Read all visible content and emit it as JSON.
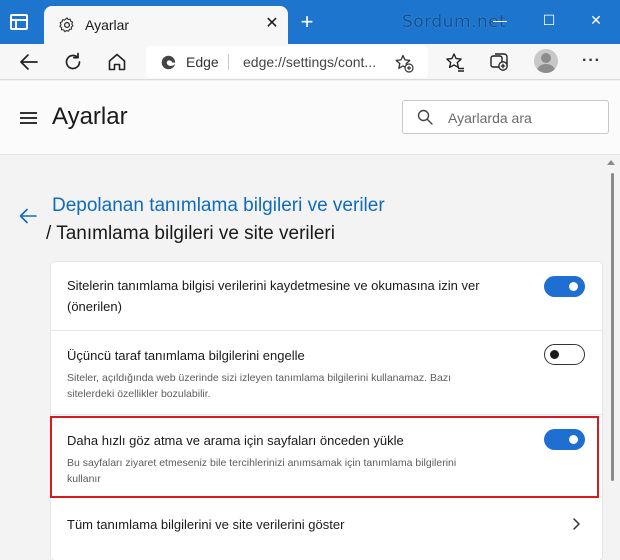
{
  "window": {
    "tab_title": "Ayarlar",
    "tab_close": "✕",
    "new_tab": "+",
    "watermark": "Sordum.net",
    "controls": {
      "minimize": "—",
      "maximize": "☐",
      "close": "✕"
    }
  },
  "addressbar": {
    "edge_label": "Edge",
    "url": "edge://settings/cont..."
  },
  "settings": {
    "title": "Ayarlar",
    "search_placeholder": "Ayarlarda ara"
  },
  "breadcrumb": {
    "parent": "Depolanan tanımlama bilgileri ve veriler",
    "current": "/ Tanımlama bilgileri ve site verileri"
  },
  "options": [
    {
      "title_line1": "Sitelerin tanımlama bilgisi verilerini kaydetmesine ve okumasına izin ver",
      "title_line2": "(önerilen)",
      "enabled": true
    },
    {
      "title": "Üçüncü taraf tanımlama bilgilerini engelle",
      "desc_line1": "Siteler, açıldığında web üzerinde sizi izleyen tanımlama bilgilerini kullanamaz. Bazı",
      "desc_line2": "sitelerdeki özellikler bozulabilir.",
      "enabled": false
    },
    {
      "title": "Daha hızlı göz atma ve arama için sayfaları önceden yükle",
      "desc_line1": "Bu sayfaları ziyaret etmeseniz bile tercihlerinizi anımsamak için tanımlama bilgilerini",
      "desc_line2": "kullanır",
      "enabled": true,
      "highlighted": true
    }
  ],
  "link_row": {
    "title": "Tüm tanımlama bilgilerini ve site verilerini göster"
  },
  "colors": {
    "titlebar": "#1d75cd",
    "accent": "#1f6ed1",
    "link": "#0f6cbd",
    "highlight_border": "#d9191f"
  }
}
